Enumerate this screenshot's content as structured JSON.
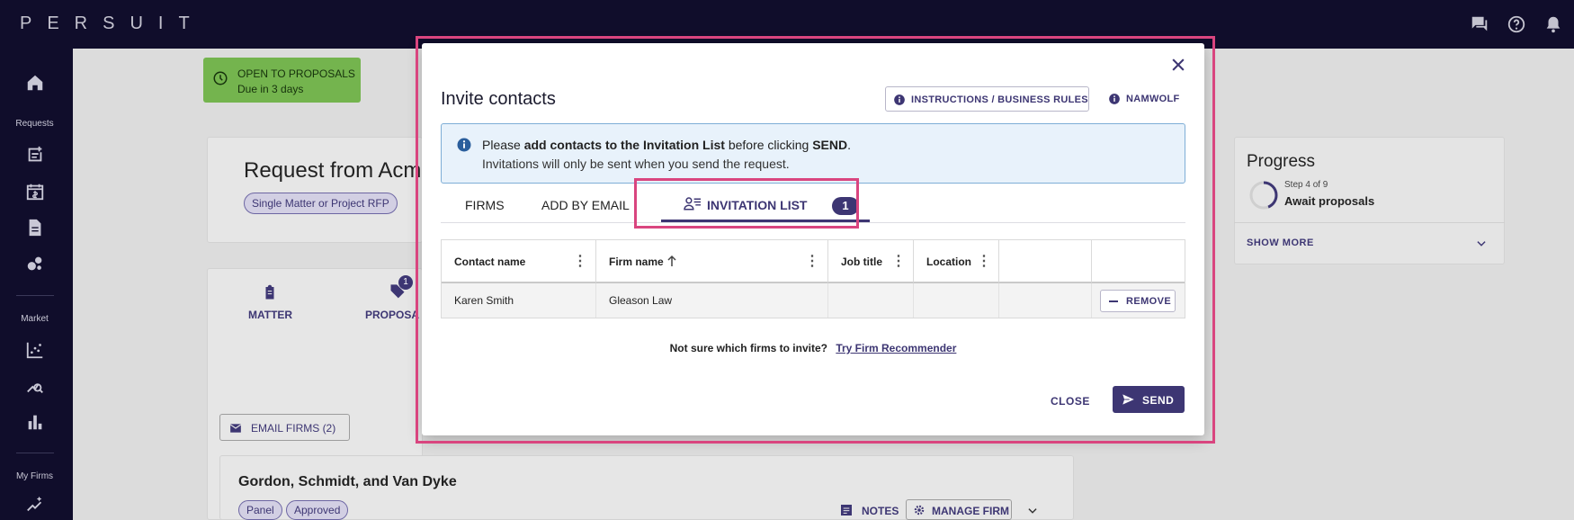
{
  "app": {
    "logo": "PERSUIT"
  },
  "sidenav": {
    "requests_label": "Requests",
    "market_label": "Market",
    "my_firms_label": "My Firms"
  },
  "background": {
    "status": {
      "line1": "OPEN TO PROPOSALS",
      "line2": "Due in 3 days"
    },
    "request_title": "Request from Acm",
    "pill_single": "Single Matter or Project RFP",
    "tab_matter": "MATTER",
    "tab_proposals": "PROPOSA",
    "proposals_badge": "1",
    "email_firms": "EMAIL FIRMS (2)",
    "firm_card_title": "Gordon, Schmidt, and Van Dyke",
    "pill_panel": "Panel",
    "pill_approved": "Approved",
    "notes": "NOTES",
    "manage_firm": "MANAGE FIRM",
    "progress": {
      "title": "Progress",
      "step": "Step 4 of 9",
      "name": "Await proposals",
      "fraction": 0.44,
      "show_more": "SHOW MORE"
    }
  },
  "modal": {
    "title": "Invite contacts",
    "instructions_button": "INSTRUCTIONS / BUSINESS RULES",
    "namwolf_button": "NAMWOLF",
    "info": {
      "pre": "Please ",
      "bold1": "add contacts to the Invitation List",
      "mid": " before clicking ",
      "bold2": "SEND",
      "post": ".",
      "line2": "Invitations will only be sent when you send the request."
    },
    "tabs": {
      "firms": "FIRMS",
      "add_by_email": "ADD BY EMAIL",
      "invitation_list": "INVITATION LIST",
      "invitation_count": "1"
    },
    "table": {
      "headers": {
        "contact_name": "Contact name",
        "firm_name": "Firm name",
        "job_title": "Job title",
        "location": "Location"
      },
      "rows": [
        {
          "contact_name": "Karen Smith",
          "firm_name": "Gleason Law",
          "job_title": "",
          "location": "",
          "action": "REMOVE"
        }
      ]
    },
    "recommender": {
      "question": "Not sure which firms to invite?",
      "link": "Try Firm Recommender"
    },
    "close_button": "CLOSE",
    "send_button": "SEND"
  },
  "colors": {
    "brand": "#3d3673",
    "nav_bg": "#100d2b",
    "highlight": "#d9457f",
    "status_green": "#74b44e",
    "info_bg": "#e8f2fb"
  }
}
